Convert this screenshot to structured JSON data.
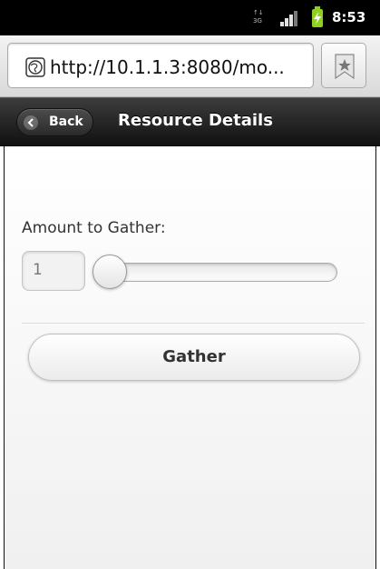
{
  "status_bar": {
    "time": "8:53",
    "network_icon": "data-network-icon",
    "signal_icon": "signal-strength-icon",
    "battery_icon": "battery-charging-icon"
  },
  "browser": {
    "url": "http://10.1.1.3:8080/mo...",
    "globe_icon": "globe-icon",
    "bookmark_icon": "bookmark-star-icon"
  },
  "header": {
    "back_label": "Back",
    "title": "Resource Details"
  },
  "form": {
    "amount_label": "Amount to Gather:",
    "amount_value": "1",
    "slider_position": 0,
    "gather_label": "Gather"
  },
  "colors": {
    "header_bg": "#1a1a1a",
    "battery": "#8fd11c"
  }
}
